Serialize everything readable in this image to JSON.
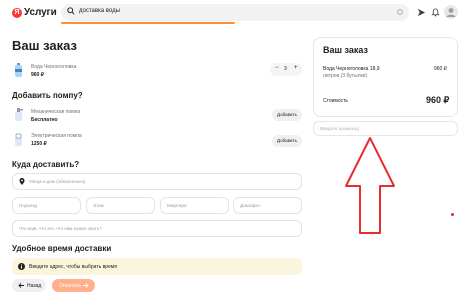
{
  "header": {
    "logo_badge": "Я",
    "logo_text": "Услуги",
    "search_value": "доставка воды",
    "icons": [
      "search-icon",
      "microphone-icon",
      "send-icon",
      "bell-icon",
      "avatar"
    ]
  },
  "order": {
    "title": "Ваш заказ",
    "product": {
      "name": "Вода Черноголовка",
      "price": "960 ₽",
      "quantity": "3",
      "minus": "−",
      "plus": "+"
    }
  },
  "pump": {
    "title": "Добавить помпу?",
    "items": [
      {
        "name": "Механическая помпа",
        "price": "Бесплатно",
        "button": "Добавить"
      },
      {
        "name": "Электрическая помпа",
        "price": "1250 ₽",
        "button": "Добавить"
      }
    ]
  },
  "address": {
    "title": "Куда доставить?",
    "street_placeholder": "Улица и дом (обязательно)",
    "entrance_placeholder": "Подъезд",
    "floor_placeholder": "Этаж",
    "apartment_placeholder": "Квартира",
    "intercom_placeholder": "Домофон",
    "comment_placeholder": "Что ещё, что это, что нам нужно знать?"
  },
  "delivery_time": {
    "title": "Удобное время доставки",
    "notice": "Введите адрес, чтобы выбрать время"
  },
  "footer": {
    "back_label": "Назад",
    "pay_label": "Оплатить"
  },
  "summary": {
    "title": "Ваш заказ",
    "item_line1": "Вода Черноголовка 18,9",
    "item_line2": "литров (3 бутылки)",
    "item_price": "960 ₽",
    "cost_label": "Стоимость",
    "cost_value": "960 ₽",
    "promo_placeholder": "Введите промокод"
  },
  "colors": {
    "accent": "#fc8d3a",
    "arrow": "#e62e2e",
    "notice_bg": "#fcf5dd"
  }
}
